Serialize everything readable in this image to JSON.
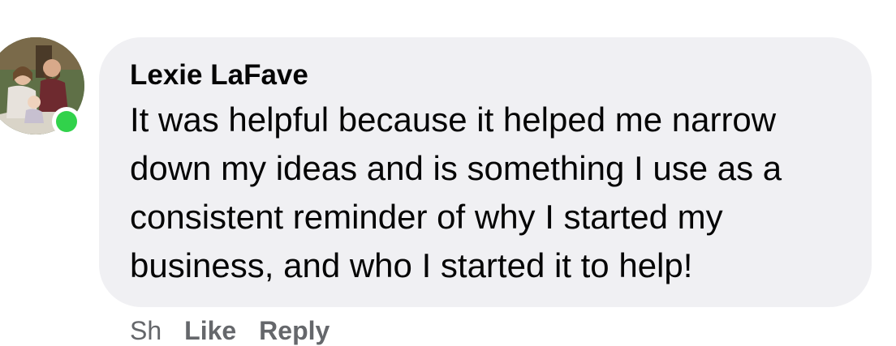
{
  "comment": {
    "author": "Lexie LaFave",
    "text": "It was helpful because it helped me narrow down my ideas and is something I use as a consistent reminder of why I started my business, and who I started it to help!",
    "online": true
  },
  "actions": {
    "time_label": "Sh",
    "like_label": "Like",
    "reply_label": "Reply"
  },
  "colors": {
    "bubble": "#f0f0f3",
    "presence": "#31d24b",
    "text": "#050505",
    "secondary": "#65676b"
  },
  "icons": {
    "avatar": "profile-photo",
    "presence": "online-status-dot"
  }
}
